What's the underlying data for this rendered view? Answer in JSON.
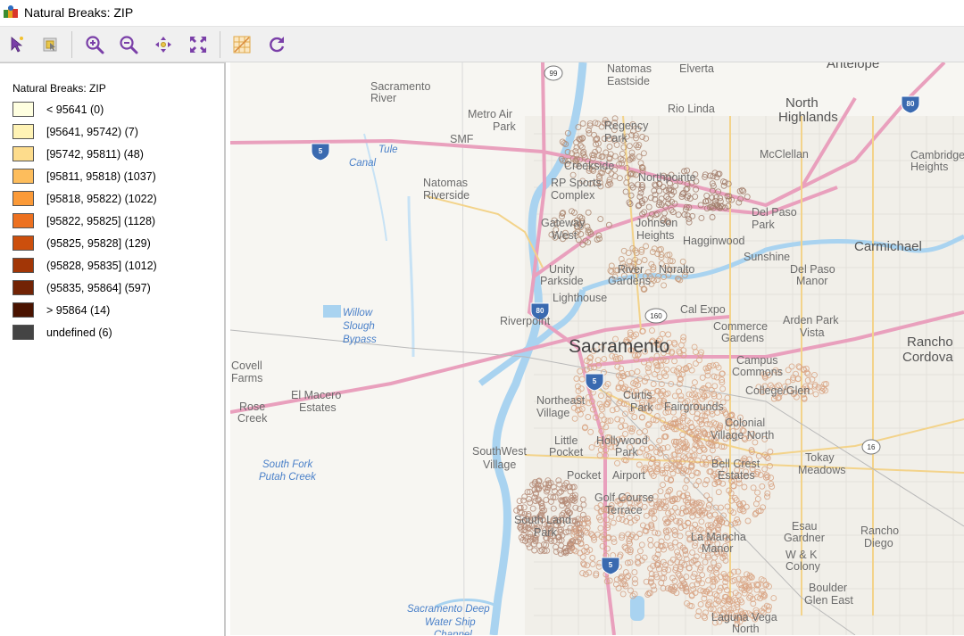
{
  "window": {
    "title": "Natural Breaks: ZIP",
    "icon": "app-map-icon"
  },
  "toolbar": {
    "buttons": [
      {
        "name": "select-pointer-icon",
        "tooltip": ""
      },
      {
        "name": "select-layer-icon",
        "tooltip": ""
      },
      {
        "name": "zoom-in-icon",
        "tooltip": ""
      },
      {
        "name": "zoom-out-icon",
        "tooltip": ""
      },
      {
        "name": "pan-icon",
        "tooltip": ""
      },
      {
        "name": "full-extent-icon",
        "tooltip": ""
      },
      {
        "name": "basemap-icon",
        "tooltip": ""
      },
      {
        "name": "refresh-icon",
        "tooltip": ""
      }
    ]
  },
  "legend": {
    "title": "Natural Breaks: ZIP",
    "items": [
      {
        "label": "< 95641 (0)",
        "color": "#ffffe0"
      },
      {
        "label": "[95641, 95742) (7)",
        "color": "#fff3b5"
      },
      {
        "label": "[95742, 95811) (48)",
        "color": "#fddc8c"
      },
      {
        "label": "[95811, 95818) (1037)",
        "color": "#fdbd5c"
      },
      {
        "label": "[95818, 95822) (1022)",
        "color": "#fb9a38"
      },
      {
        "label": "[95822, 95825] (1128)",
        "color": "#ed7120"
      },
      {
        "label": "(95825, 95828] (129)",
        "color": "#cc4f0d"
      },
      {
        "label": "(95828, 95835] (1012)",
        "color": "#a23606"
      },
      {
        "label": "(95835, 95864] (597)",
        "color": "#722305"
      },
      {
        "label": "> 95864 (14)",
        "color": "#4a1300"
      },
      {
        "label": "undefined (6)",
        "color": "#444444"
      }
    ]
  },
  "map": {
    "labels": [
      {
        "text": "Natomas",
        "cls": "mlabel"
      },
      {
        "text": "Eastside",
        "cls": "mlabel"
      },
      {
        "text": "Elverta",
        "cls": "mlabel"
      },
      {
        "text": "Antelope",
        "cls": "mlabel-big"
      },
      {
        "text": "Sacramento",
        "cls": "mlabel"
      },
      {
        "text": "River",
        "cls": "mlabel"
      },
      {
        "text": "Metro Air",
        "cls": "mlabel"
      },
      {
        "text": "Park",
        "cls": "mlabel"
      },
      {
        "text": "SMF",
        "cls": "mlabel"
      },
      {
        "text": "Rio Linda",
        "cls": "mlabel"
      },
      {
        "text": "North",
        "cls": "mlabel-big"
      },
      {
        "text": "Highlands",
        "cls": "mlabel-big"
      },
      {
        "text": "Regency",
        "cls": "mlabel"
      },
      {
        "text": "Park",
        "cls": "mlabel"
      },
      {
        "text": "McClellan",
        "cls": "mlabel"
      },
      {
        "text": "Cambridge",
        "cls": "mlabel"
      },
      {
        "text": "Heights",
        "cls": "mlabel"
      },
      {
        "text": "Creekside",
        "cls": "mlabel"
      },
      {
        "text": "Natomas",
        "cls": "mlabel"
      },
      {
        "text": "Riverside",
        "cls": "mlabel"
      },
      {
        "text": "RP Sports",
        "cls": "mlabel"
      },
      {
        "text": "Complex",
        "cls": "mlabel"
      },
      {
        "text": "Northpointe",
        "cls": "mlabel"
      },
      {
        "text": "Del Paso",
        "cls": "mlabel"
      },
      {
        "text": "Park",
        "cls": "mlabel"
      },
      {
        "text": "Gateway",
        "cls": "mlabel"
      },
      {
        "text": "West",
        "cls": "mlabel"
      },
      {
        "text": "Johnson",
        "cls": "mlabel"
      },
      {
        "text": "Heights",
        "cls": "mlabel"
      },
      {
        "text": "Hagginwood",
        "cls": "mlabel"
      },
      {
        "text": "Carmichael",
        "cls": "mlabel-big"
      },
      {
        "text": "Sunshine",
        "cls": "mlabel"
      },
      {
        "text": "Unity",
        "cls": "mlabel"
      },
      {
        "text": "Parkside",
        "cls": "mlabel"
      },
      {
        "text": "River",
        "cls": "mlabel"
      },
      {
        "text": "Gardens",
        "cls": "mlabel"
      },
      {
        "text": "Noralto",
        "cls": "mlabel"
      },
      {
        "text": "Del Paso",
        "cls": "mlabel"
      },
      {
        "text": "Manor",
        "cls": "mlabel"
      },
      {
        "text": "Lighthouse",
        "cls": "mlabel"
      },
      {
        "text": "Cal Expo",
        "cls": "mlabel"
      },
      {
        "text": "Riverpoint",
        "cls": "mlabel"
      },
      {
        "text": "Commerce",
        "cls": "mlabel"
      },
      {
        "text": "Gardens",
        "cls": "mlabel"
      },
      {
        "text": "Arden Park",
        "cls": "mlabel"
      },
      {
        "text": "Vista",
        "cls": "mlabel"
      },
      {
        "text": "Rancho",
        "cls": "mlabel-big"
      },
      {
        "text": "Cordova",
        "cls": "mlabel-big"
      },
      {
        "text": "Sacramento",
        "cls": "mcity"
      },
      {
        "text": "Campus",
        "cls": "mlabel"
      },
      {
        "text": "Commons",
        "cls": "mlabel"
      },
      {
        "text": "College/Glen",
        "cls": "mlabel"
      },
      {
        "text": "Covell",
        "cls": "mlabel"
      },
      {
        "text": "Farms",
        "cls": "mlabel"
      },
      {
        "text": "El Macero",
        "cls": "mlabel"
      },
      {
        "text": "Estates",
        "cls": "mlabel"
      },
      {
        "text": "Curtis",
        "cls": "mlabel"
      },
      {
        "text": "Park",
        "cls": "mlabel"
      },
      {
        "text": "Northeast",
        "cls": "mlabel"
      },
      {
        "text": "Village",
        "cls": "mlabel"
      },
      {
        "text": "Fairgrounds",
        "cls": "mlabel"
      },
      {
        "text": "Colonial",
        "cls": "mlabel"
      },
      {
        "text": "Village North",
        "cls": "mlabel"
      },
      {
        "text": "Rose",
        "cls": "mlabel"
      },
      {
        "text": "Creek",
        "cls": "mlabel"
      },
      {
        "text": "Little",
        "cls": "mlabel"
      },
      {
        "text": "Pocket",
        "cls": "mlabel"
      },
      {
        "text": "Hollywood",
        "cls": "mlabel"
      },
      {
        "text": "Park",
        "cls": "mlabel"
      },
      {
        "text": "Tokay",
        "cls": "mlabel"
      },
      {
        "text": "Meadows",
        "cls": "mlabel"
      },
      {
        "text": "SouthWest",
        "cls": "mlabel"
      },
      {
        "text": "Village",
        "cls": "mlabel"
      },
      {
        "text": "Bell Crest",
        "cls": "mlabel"
      },
      {
        "text": "Estates",
        "cls": "mlabel"
      },
      {
        "text": "Pocket",
        "cls": "mlabel"
      },
      {
        "text": "Airport",
        "cls": "mlabel"
      },
      {
        "text": "Golf Course",
        "cls": "mlabel"
      },
      {
        "text": "Terrace",
        "cls": "mlabel"
      },
      {
        "text": "South Land",
        "cls": "mlabel"
      },
      {
        "text": "Park",
        "cls": "mlabel"
      },
      {
        "text": "Esau",
        "cls": "mlabel"
      },
      {
        "text": "Gardner",
        "cls": "mlabel"
      },
      {
        "text": "Rancho",
        "cls": "mlabel"
      },
      {
        "text": "Diego",
        "cls": "mlabel"
      },
      {
        "text": "La Mancha",
        "cls": "mlabel"
      },
      {
        "text": "Manor",
        "cls": "mlabel"
      },
      {
        "text": "W & K",
        "cls": "mlabel"
      },
      {
        "text": "Colony",
        "cls": "mlabel"
      },
      {
        "text": "Boulder",
        "cls": "mlabel"
      },
      {
        "text": "Glen East",
        "cls": "mlabel"
      },
      {
        "text": "Laguna Vega",
        "cls": "mlabel"
      },
      {
        "text": "North",
        "cls": "mlabel"
      },
      {
        "text": "Tule",
        "cls": "mwater"
      },
      {
        "text": "Canal",
        "cls": "mwater"
      },
      {
        "text": "Willow",
        "cls": "mwater"
      },
      {
        "text": "Slough",
        "cls": "mwater"
      },
      {
        "text": "Bypass",
        "cls": "mwater"
      },
      {
        "text": "South Fork",
        "cls": "mwater"
      },
      {
        "text": "Putah Creek",
        "cls": "mwater"
      },
      {
        "text": "Sacramento Deep",
        "cls": "mwater"
      },
      {
        "text": "Water Ship",
        "cls": "mwater"
      },
      {
        "text": "Channel",
        "cls": "mwater"
      }
    ],
    "shields": [
      {
        "text": "99",
        "type": "state"
      },
      {
        "text": "80",
        "type": "interstate"
      },
      {
        "text": "5",
        "type": "interstate"
      },
      {
        "text": "80",
        "type": "interstate"
      },
      {
        "text": "160",
        "type": "state"
      },
      {
        "text": "5",
        "type": "interstate"
      },
      {
        "text": "16",
        "type": "state"
      },
      {
        "text": "5",
        "type": "interstate"
      }
    ]
  }
}
